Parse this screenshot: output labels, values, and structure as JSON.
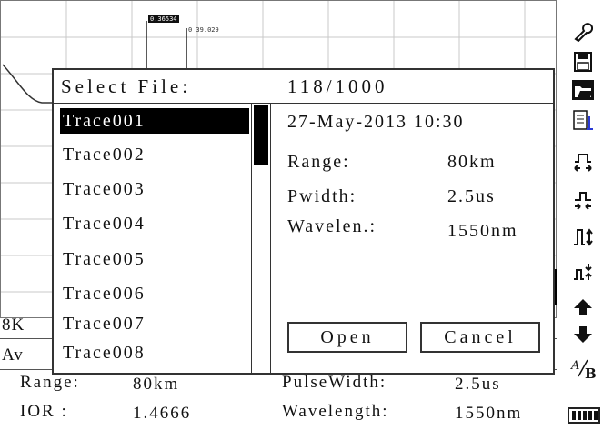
{
  "marker": {
    "a_label": "0.36534",
    "b_label": "0 39.029"
  },
  "background_hints": {
    "resolution_prefix": "8K",
    "average_prefix": "Av"
  },
  "dialog": {
    "title": "Select File:",
    "counter": "118/1000",
    "files": [
      "Trace001",
      "Trace002",
      "Trace003",
      "Trace004",
      "Trace005",
      "Trace006",
      "Trace007",
      "Trace008"
    ],
    "selected_index": 0,
    "details": {
      "datetime": "27-May-2013 10:30",
      "range_label": "Range:",
      "range_value": "80km",
      "pwidth_label": "Pwidth:",
      "pwidth_value": "2.5us",
      "wavelen_label": "Wavelen.:",
      "wavelen_value": "1550nm"
    },
    "open_label": "Open",
    "cancel_label": "Cancel"
  },
  "status": {
    "range_label": "Range:",
    "range_value": "80km",
    "pulsewidth_label": "PulseWidth:",
    "pulsewidth_value": "2.5us",
    "ior_label": "IOR  :",
    "ior_value": "1.4666",
    "wavelength_label": "Wavelength:",
    "wavelength_value": "1550nm"
  },
  "toolbar": {
    "icons": [
      "wrench-icon",
      "save-icon",
      "open-folder-icon",
      "file-list-icon",
      "pulse-expand-icon",
      "pulse-shrink-icon",
      "pulse-up-icon",
      "pulse-adjust-icon",
      "arrow-up-icon",
      "arrow-down-icon",
      "a-b-marker-icon"
    ],
    "ab_label": "A/B"
  },
  "battery_level": 1.0
}
